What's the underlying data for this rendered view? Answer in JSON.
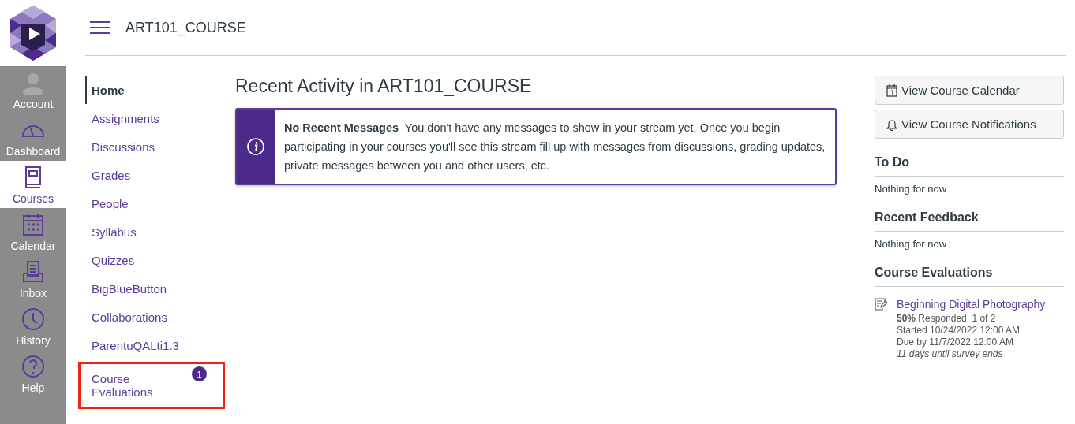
{
  "global_nav": [
    {
      "label": "Account",
      "kind": "account",
      "selected": false
    },
    {
      "label": "Dashboard",
      "kind": "dashboard",
      "selected": false
    },
    {
      "label": "Courses",
      "kind": "courses",
      "selected": true
    },
    {
      "label": "Calendar",
      "kind": "calendar",
      "selected": false
    },
    {
      "label": "Inbox",
      "kind": "inbox",
      "selected": false
    },
    {
      "label": "History",
      "kind": "history",
      "selected": false
    },
    {
      "label": "Help",
      "kind": "help",
      "selected": false
    }
  ],
  "header": {
    "title": "ART101_COURSE"
  },
  "course_nav": [
    {
      "label": "Home",
      "selected": true,
      "highlighted": false
    },
    {
      "label": "Assignments",
      "selected": false,
      "highlighted": false
    },
    {
      "label": "Discussions",
      "selected": false,
      "highlighted": false
    },
    {
      "label": "Grades",
      "selected": false,
      "highlighted": false
    },
    {
      "label": "People",
      "selected": false,
      "highlighted": false
    },
    {
      "label": "Syllabus",
      "selected": false,
      "highlighted": false
    },
    {
      "label": "Quizzes",
      "selected": false,
      "highlighted": false
    },
    {
      "label": "BigBlueButton",
      "selected": false,
      "highlighted": false
    },
    {
      "label": "Collaborations",
      "selected": false,
      "highlighted": false
    },
    {
      "label": "ParentuQALti1.3",
      "selected": false,
      "highlighted": false
    },
    {
      "label": "Course Evaluations",
      "selected": false,
      "highlighted": true,
      "badge": "1"
    }
  ],
  "main": {
    "heading": "Recent Activity in ART101_COURSE",
    "alert": {
      "title": "No Recent Messages",
      "message": "You don't have any messages to show in your stream yet. Once you begin participating in your courses you'll see this stream fill up with messages from discussions, grading updates, private messages between you and other users, etc."
    }
  },
  "sidebar": {
    "buttons": [
      {
        "label": "View Course Calendar",
        "kind": "calendar"
      },
      {
        "label": "View Course Notifications",
        "kind": "bell"
      }
    ],
    "sections": [
      {
        "title": "To Do",
        "empty": "Nothing for now"
      },
      {
        "title": "Recent Feedback",
        "empty": "Nothing for now"
      },
      {
        "title": "Course Evaluations",
        "evaluations": [
          {
            "title": "Beginning Digital Photography",
            "responded": "**50%** Responded, 1 of 2",
            "started": "Started 10/24/2022 12:00 AM",
            "due": "Due by 11/7/2022 12:00 AM",
            "remaining": "11 days until survey ends"
          }
        ]
      }
    ]
  }
}
